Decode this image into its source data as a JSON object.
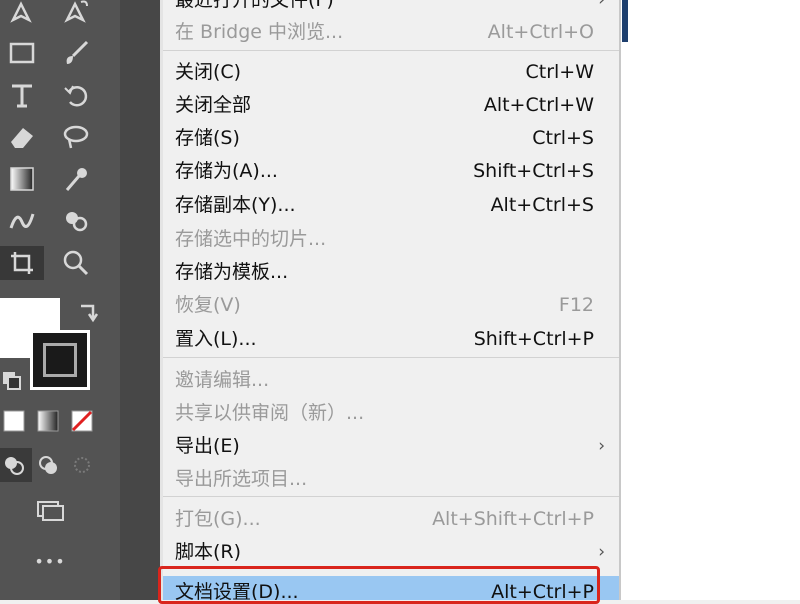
{
  "menu": {
    "items": [
      {
        "label": "最近打开的文件(F)",
        "shortcut": "",
        "submenu": true,
        "enabled": true
      },
      {
        "label": "在 Bridge 中浏览...",
        "shortcut": "Alt+Ctrl+O",
        "enabled": false
      },
      {
        "label": "关闭(C)",
        "shortcut": "Ctrl+W",
        "enabled": true
      },
      {
        "label": "关闭全部",
        "shortcut": "Alt+Ctrl+W",
        "enabled": true
      },
      {
        "label": "存储(S)",
        "shortcut": "Ctrl+S",
        "enabled": true
      },
      {
        "label": "存储为(A)...",
        "shortcut": "Shift+Ctrl+S",
        "enabled": true
      },
      {
        "label": "存储副本(Y)...",
        "shortcut": "Alt+Ctrl+S",
        "enabled": true
      },
      {
        "label": "存储选中的切片...",
        "shortcut": "",
        "enabled": false
      },
      {
        "label": "存储为模板...",
        "shortcut": "",
        "enabled": true
      },
      {
        "label": "恢复(V)",
        "shortcut": "F12",
        "enabled": false
      },
      {
        "label": "置入(L)...",
        "shortcut": "Shift+Ctrl+P",
        "enabled": true
      },
      {
        "label": "邀请编辑...",
        "shortcut": "",
        "enabled": false
      },
      {
        "label": "共享以供审阅（新）...",
        "shortcut": "",
        "enabled": false
      },
      {
        "label": "导出(E)",
        "shortcut": "",
        "submenu": true,
        "enabled": true
      },
      {
        "label": "导出所选项目...",
        "shortcut": "",
        "enabled": false
      },
      {
        "label": "打包(G)...",
        "shortcut": "Alt+Shift+Ctrl+P",
        "enabled": false
      },
      {
        "label": "脚本(R)",
        "shortcut": "",
        "submenu": true,
        "enabled": true
      },
      {
        "label": "文档设置(D)...",
        "shortcut": "Alt+Ctrl+P",
        "enabled": true,
        "highlighted": true
      }
    ],
    "submenu_arrow": "›"
  },
  "toolbar": {
    "icons": [
      "pen-icon",
      "curvature-pen-icon",
      "rectangle-icon",
      "paintbrush-icon",
      "type-icon",
      "rotate-icon",
      "eraser-icon",
      "lasso-icon",
      "gradient-icon",
      "eyedropper-icon",
      "blend-icon",
      "shape-builder-icon",
      "artboard-icon",
      "zoom-icon",
      "swap-icon",
      "default-colors-icon",
      "fill-color-icon",
      "gradient-swatch-icon",
      "none-swatch-icon",
      "draw-normal-icon",
      "draw-behind-icon",
      "draw-inside-icon",
      "screen-mode-icon",
      "more-tools-icon"
    ],
    "more_label": "•••"
  },
  "colors": {
    "highlight": "#99c7f2",
    "outline": "#d9251c",
    "toolbar_bg": "#535353"
  }
}
